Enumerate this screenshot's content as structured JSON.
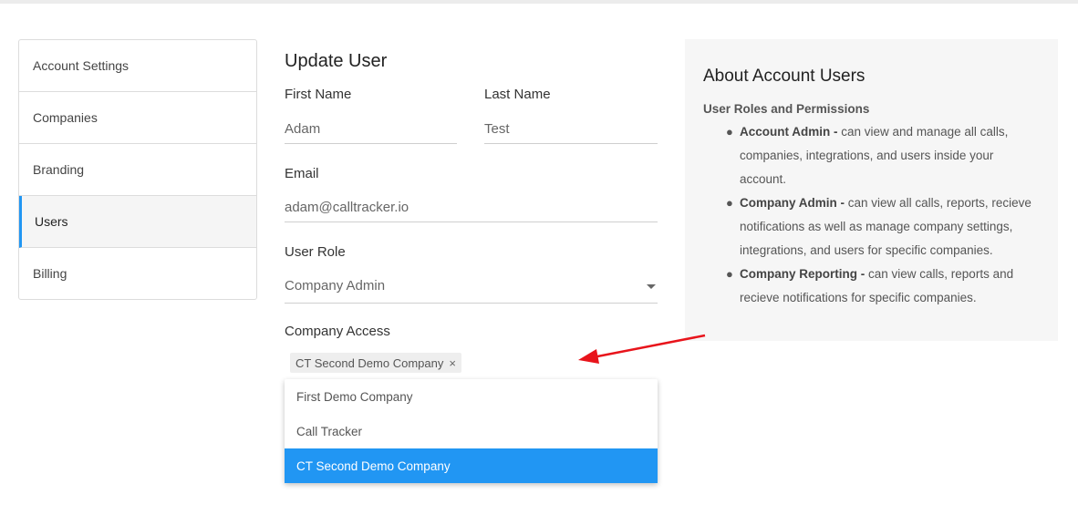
{
  "sidebar": {
    "items": [
      {
        "label": "Account Settings"
      },
      {
        "label": "Companies"
      },
      {
        "label": "Branding"
      },
      {
        "label": "Users"
      },
      {
        "label": "Billing"
      }
    ],
    "active": "Users"
  },
  "form": {
    "title": "Update User",
    "first_name": {
      "label": "First Name",
      "value": "Adam"
    },
    "last_name": {
      "label": "Last Name",
      "value": "Test"
    },
    "email": {
      "label": "Email",
      "value": "adam@calltracker.io"
    },
    "user_role": {
      "label": "User Role",
      "value": "Company Admin"
    },
    "company_access": {
      "label": "Company Access",
      "selected_chip": "CT Second Demo Company",
      "chip_remove": "×",
      "options": [
        {
          "label": "First Demo Company"
        },
        {
          "label": "Call Tracker"
        },
        {
          "label": "CT Second Demo Company"
        }
      ],
      "highlighted": "CT Second Demo Company"
    }
  },
  "info": {
    "title": "About Account Users",
    "subtitle": "User Roles and Permissions",
    "roles": [
      {
        "name": "Account Admin -",
        "desc": "can view and manage all calls, companies, integrations, and users inside your account."
      },
      {
        "name": "Company Admin -",
        "desc": "can view all calls, reports, recieve notifications as well as manage company settings, integrations, and users for specific companies."
      },
      {
        "name": "Company Reporting -",
        "desc": "can view calls, reports and recieve notifications for specific companies."
      }
    ]
  },
  "colors": {
    "accent": "#2196f3",
    "annotation_arrow": "#e8141b"
  },
  "icons": {
    "remove_chip": "close-icon",
    "select_caret": "caret-down-icon",
    "annotation": "red-arrow"
  }
}
